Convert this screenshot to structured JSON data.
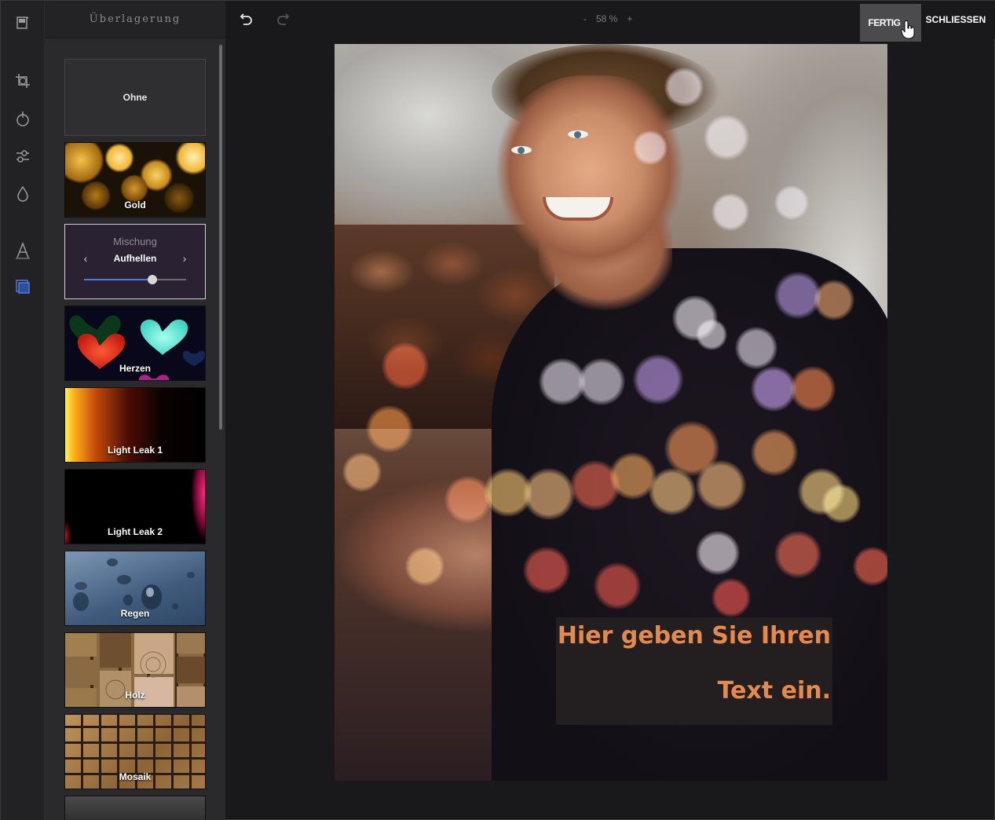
{
  "panel": {
    "title": "Überlagerung",
    "tiles": [
      {
        "label": "Ohne"
      },
      {
        "label": "Gold"
      },
      {
        "label": "Mischung",
        "value": "Aufhellen",
        "slider": 0.67
      },
      {
        "label": "Herzen"
      },
      {
        "label": "Light Leak 1"
      },
      {
        "label": "Light Leak 2"
      },
      {
        "label": "Regen"
      },
      {
        "label": "Holz"
      },
      {
        "label": "Mosaik"
      }
    ]
  },
  "rail": {
    "icons": [
      "document-icon",
      "crop-icon",
      "filter-icon",
      "adjust-icon",
      "drop-icon",
      "text-icon",
      "overlay-icon"
    ]
  },
  "topbar": {
    "zoom_minus": "-",
    "zoom_value": "58 %",
    "zoom_plus": "+",
    "done_label": "FERTIG",
    "close_label": "SCHLIESSEN"
  },
  "canvas": {
    "text_line1": "Hier geben Sie Ihren",
    "text_line2": "Text ein."
  },
  "colors": {
    "accent": "#4b7be6",
    "text_overlay": "#e58a4c"
  }
}
